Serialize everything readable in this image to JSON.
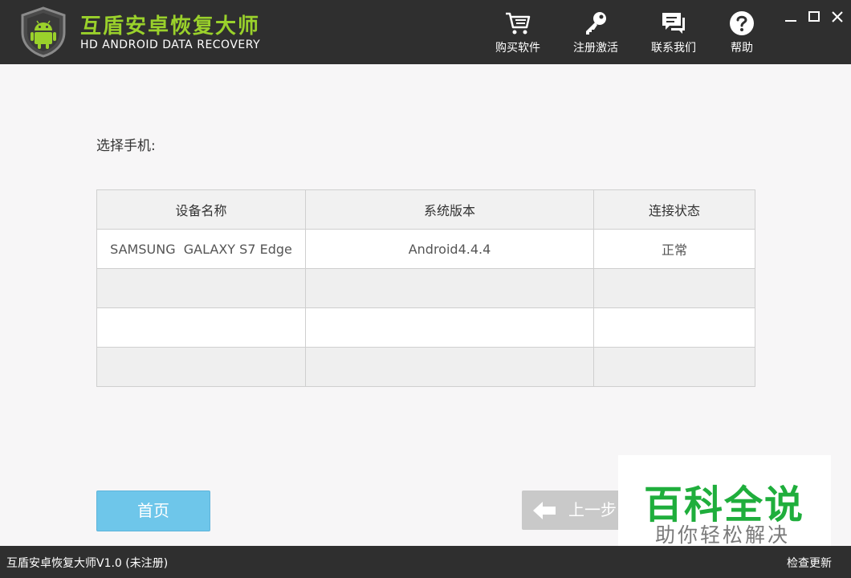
{
  "header": {
    "title": "互盾安卓恢复大师",
    "subtitle": "HD ANDROID DATA RECOVERY",
    "nav": [
      {
        "label": "购买软件",
        "icon": "cart-icon"
      },
      {
        "label": "注册激活",
        "icon": "key-icon"
      },
      {
        "label": "联系我们",
        "icon": "chat-icon"
      },
      {
        "label": "帮助",
        "icon": "help-icon"
      }
    ],
    "window_controls": [
      "minimize-icon",
      "maximize-icon",
      "close-icon"
    ]
  },
  "main": {
    "prompt": "选择手机:",
    "table": {
      "columns": [
        "设备名称",
        "系统版本",
        "连接状态"
      ],
      "rows": [
        [
          "SAMSUNG  GALAXY S7 Edge",
          "Android4.4.4",
          "正常"
        ],
        [
          "",
          "",
          ""
        ],
        [
          "",
          "",
          ""
        ],
        [
          "",
          "",
          ""
        ]
      ]
    },
    "home_button": "首页",
    "prev_button": "上一步"
  },
  "watermark": {
    "main": "百科全说",
    "sub": "助你轻松解决"
  },
  "statusbar": {
    "text": "互盾安卓恢复大师V1.0 (未注册)",
    "check_update": "检查更新"
  },
  "colors": {
    "titlebar_bg": "#2f2f2f",
    "brand_green": "#9ad12b",
    "home_button": "#6ec6ea",
    "watermark_green": "#1fae3c"
  }
}
